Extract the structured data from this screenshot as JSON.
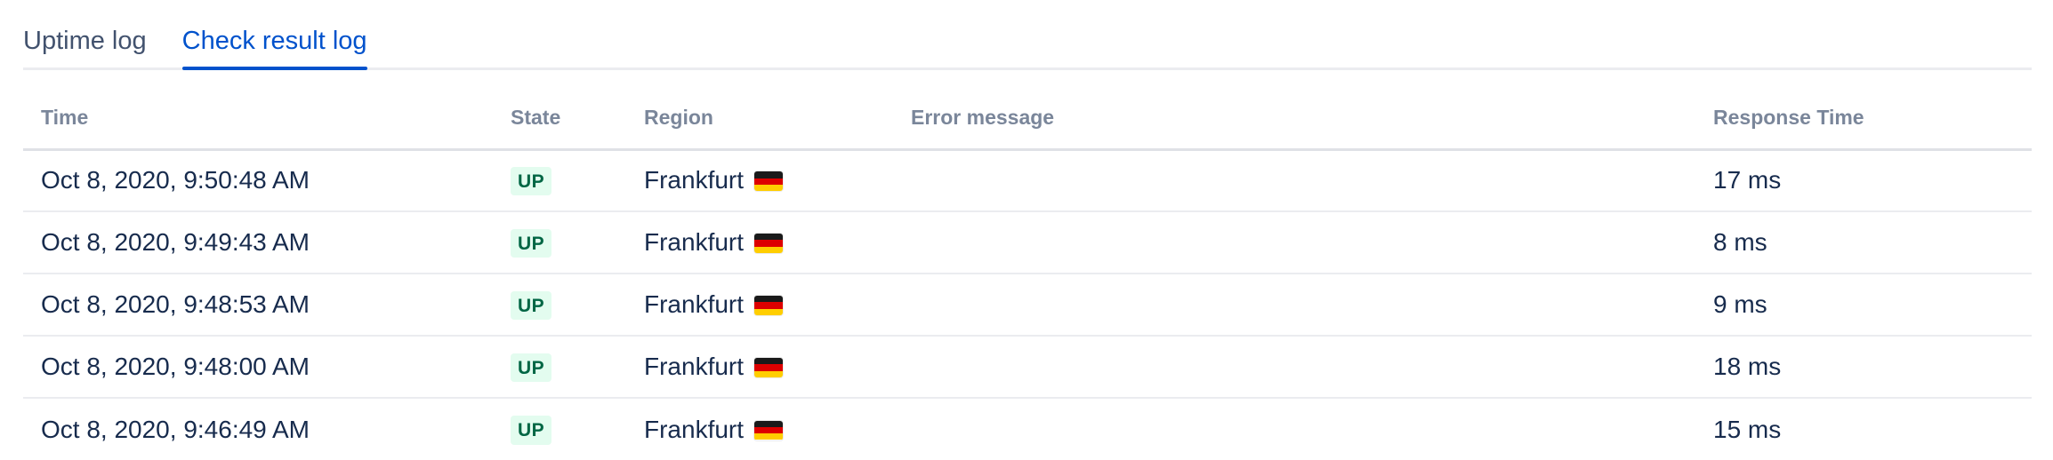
{
  "tabs": [
    {
      "label": "Uptime log",
      "active": false
    },
    {
      "label": "Check result log",
      "active": true
    }
  ],
  "table": {
    "columns": [
      "Time",
      "State",
      "Region",
      "Error message",
      "Response Time"
    ],
    "rows": [
      {
        "time": "Oct 8, 2020, 9:50:48 AM",
        "state": "UP",
        "region": "Frankfurt",
        "region_flag": "germany-flag",
        "error": "",
        "response": "17 ms"
      },
      {
        "time": "Oct 8, 2020, 9:49:43 AM",
        "state": "UP",
        "region": "Frankfurt",
        "region_flag": "germany-flag",
        "error": "",
        "response": "8 ms"
      },
      {
        "time": "Oct 8, 2020, 9:48:53 AM",
        "state": "UP",
        "region": "Frankfurt",
        "region_flag": "germany-flag",
        "error": "",
        "response": "9 ms"
      },
      {
        "time": "Oct 8, 2020, 9:48:00 AM",
        "state": "UP",
        "region": "Frankfurt",
        "region_flag": "germany-flag",
        "error": "",
        "response": "18 ms"
      },
      {
        "time": "Oct 8, 2020, 9:46:49 AM",
        "state": "UP",
        "region": "Frankfurt",
        "region_flag": "germany-flag",
        "error": "",
        "response": "15 ms"
      }
    ]
  },
  "colors": {
    "accent": "#0052cc",
    "text": "#172b4d",
    "header_text": "#7a869a",
    "up_bg": "#e3fcef",
    "up_text": "#006644"
  }
}
